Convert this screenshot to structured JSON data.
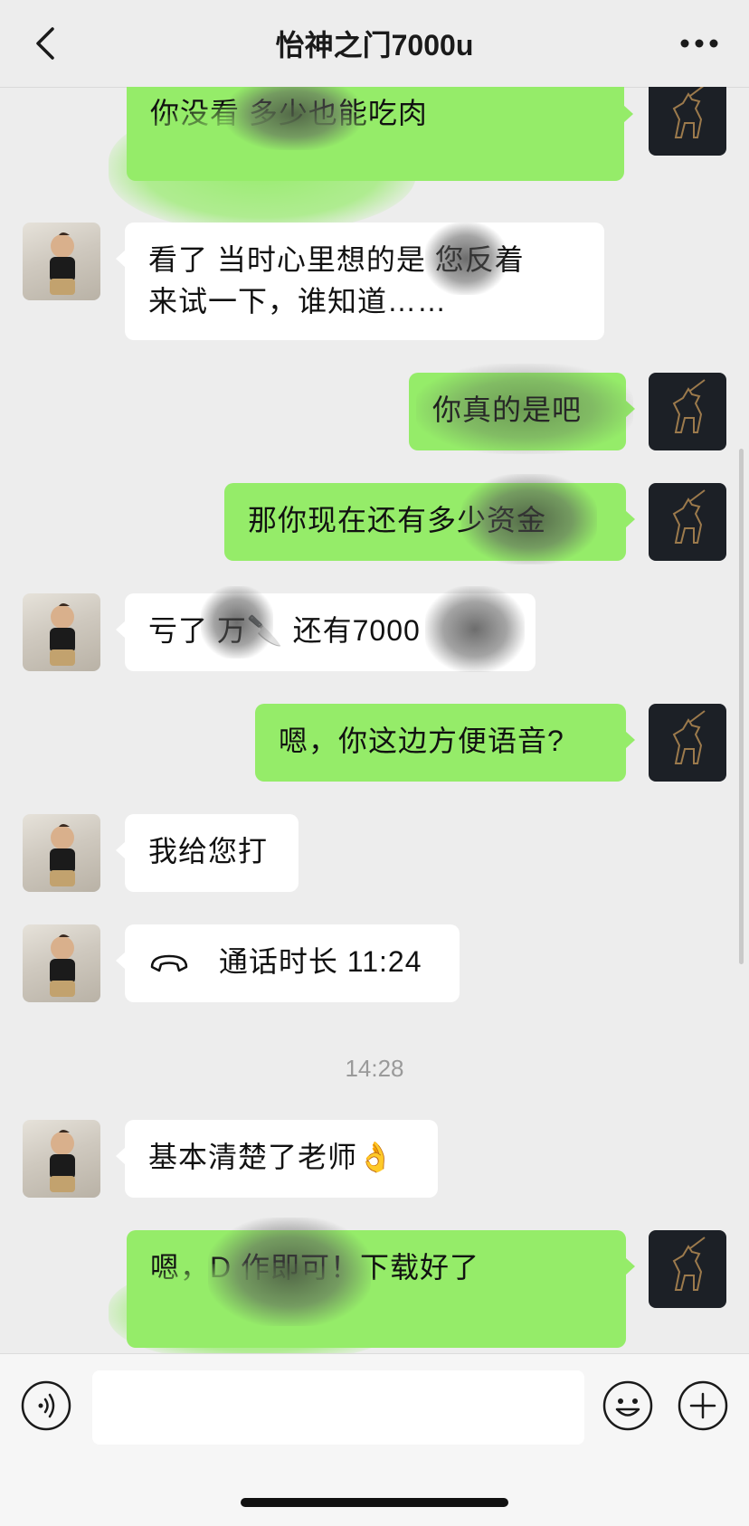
{
  "header": {
    "title": "怡神之门7000u"
  },
  "messages": [
    {
      "side": "out",
      "text": "你没看         多少也能吃肉"
    },
    {
      "side": "in",
      "text_line1": "看了 当时心里想的是   您反着",
      "text_line2": "来试一下，谁知道……"
    },
    {
      "side": "out",
      "text": "你真的是吧"
    },
    {
      "side": "out",
      "text": "那你现在还有多少资金"
    },
    {
      "side": "in",
      "text": "亏了   万🔪 还有7000"
    },
    {
      "side": "out",
      "text": "嗯，你这边方便语音?"
    },
    {
      "side": "in",
      "text": "我给您打"
    },
    {
      "side": "in",
      "text": "通话时长 11:24",
      "icon": "phone-hangup-icon"
    },
    {
      "side": "in",
      "text": "基本清楚了老师👌"
    },
    {
      "side": "out",
      "text": "嗯，D      作即可！下载好了"
    }
  ],
  "timestamp": "14:28",
  "input": {
    "placeholder": ""
  },
  "colors": {
    "outgoing_bubble": "#95ec69",
    "incoming_bubble": "#ffffff",
    "background": "#ededed"
  }
}
